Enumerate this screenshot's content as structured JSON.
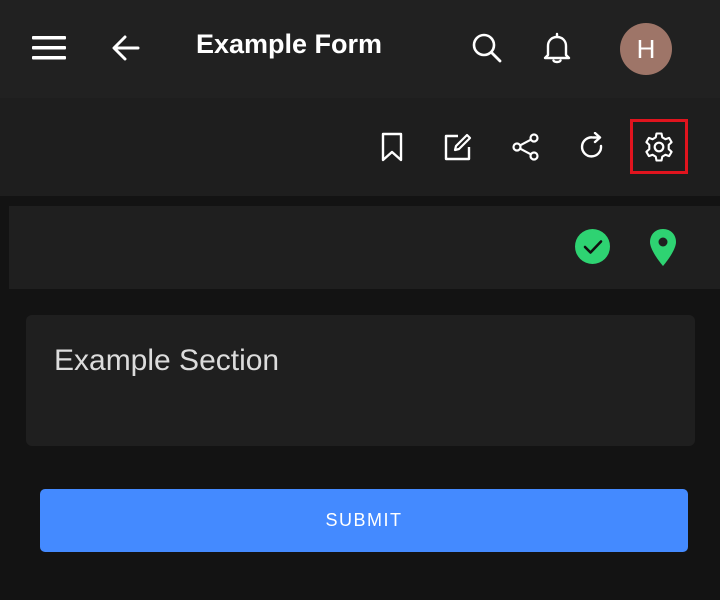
{
  "header": {
    "title": "Example Form",
    "avatar_initial": "H",
    "icons": [
      "menu-icon",
      "back-arrow-icon",
      "search-icon",
      "bell-icon"
    ]
  },
  "toolbar": {
    "icons": [
      "bookmark-icon",
      "edit-icon",
      "share-icon",
      "refresh-icon",
      "settings-icon"
    ]
  },
  "status": {
    "icons": [
      "check-circle-icon",
      "location-pin-icon"
    ]
  },
  "section": {
    "title": "Example Section"
  },
  "submit_label": "SUBMIT",
  "colors": {
    "background": "#131313",
    "appbar": "#212121",
    "toolbar": "#1e1e1e",
    "accent": "#448aff",
    "status_green": "#2ed372",
    "avatar": "#9e7568",
    "highlight": "#e0141e"
  }
}
